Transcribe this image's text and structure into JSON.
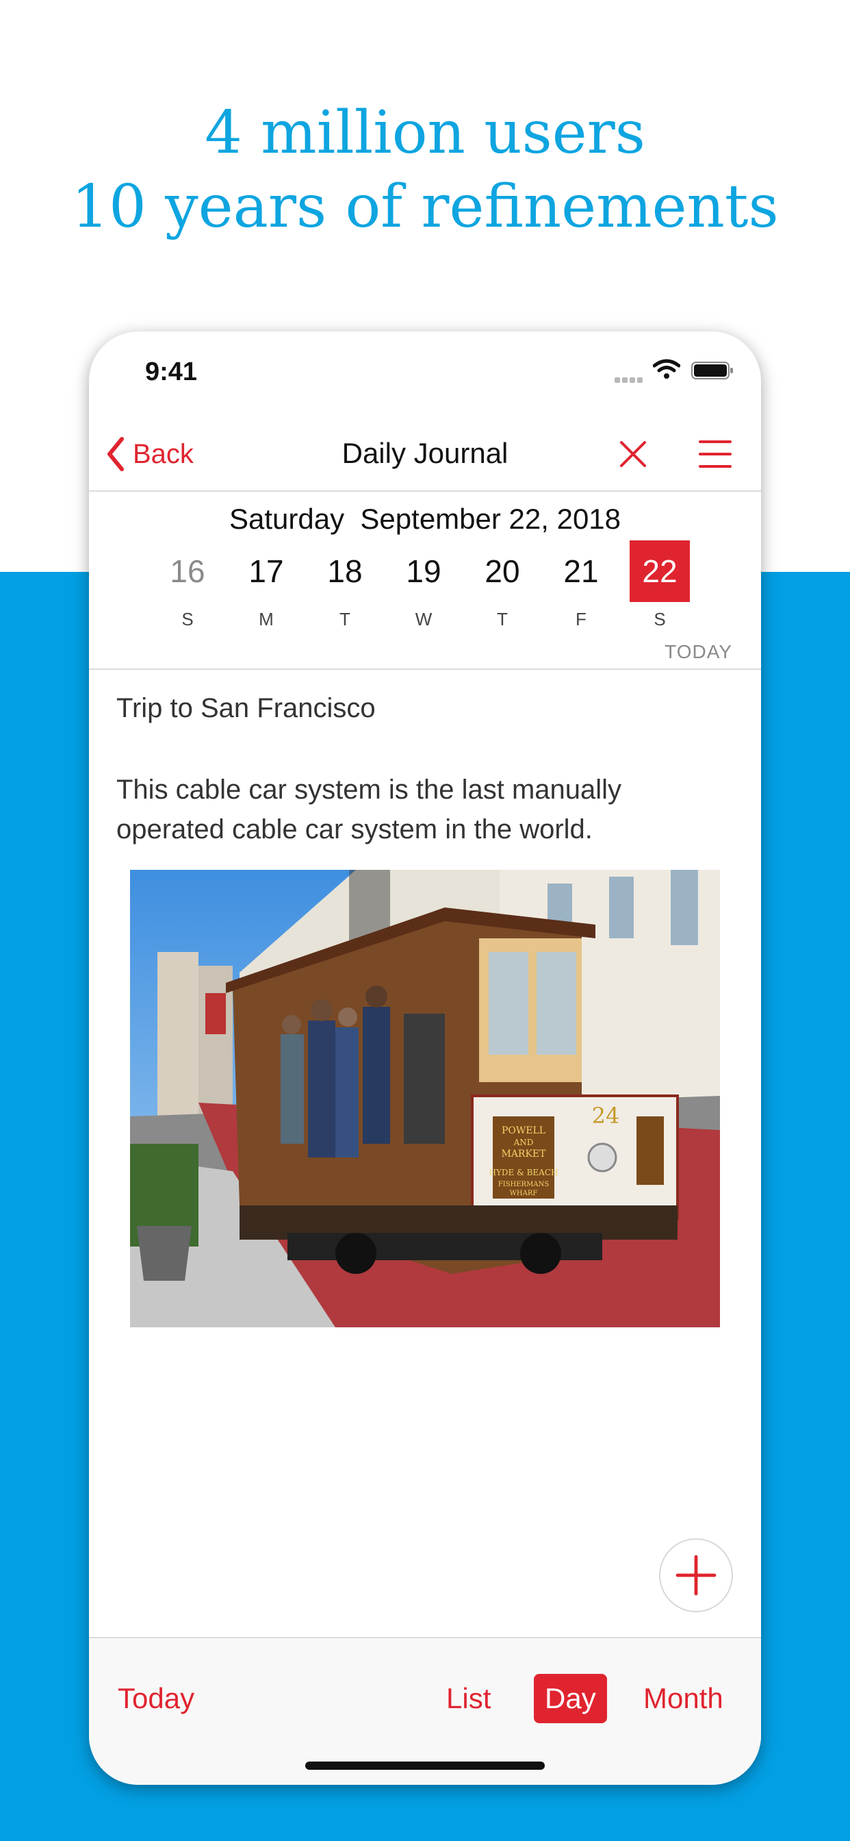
{
  "marketing": {
    "line1": "4 million users",
    "line2": "10 years of refinements"
  },
  "status_bar": {
    "time": "9:41"
  },
  "navbar": {
    "back_label": "Back",
    "title": "Daily Journal",
    "close_icon": "close-icon",
    "menu_icon": "menu-icon"
  },
  "date_header": {
    "weekday": "Saturday",
    "date": "September 22, 2018"
  },
  "week": [
    {
      "num": "16",
      "letter": "S"
    },
    {
      "num": "17",
      "letter": "M"
    },
    {
      "num": "18",
      "letter": "T"
    },
    {
      "num": "19",
      "letter": "W"
    },
    {
      "num": "20",
      "letter": "T"
    },
    {
      "num": "21",
      "letter": "F"
    },
    {
      "num": "22",
      "letter": "S"
    }
  ],
  "today_label": "TODAY",
  "entry": {
    "title": "Trip to San Francisco",
    "body": "This cable car system is the last manually operated cable car system in the world.",
    "photo": {
      "car_number": "24",
      "sign_line1": "POWELL",
      "sign_line2": "AND",
      "sign_line3": "MARKET",
      "sign_line4": "HYDE & BEACH",
      "sign_line5": "FISHERMANS",
      "sign_line6": "WHARF"
    }
  },
  "tabs": {
    "today": "Today",
    "list": "List",
    "day": "Day",
    "month": "Month"
  },
  "colors": {
    "accent": "#e0242f",
    "brand_blue": "#039fe3",
    "headline_blue": "#0ea5e0"
  }
}
